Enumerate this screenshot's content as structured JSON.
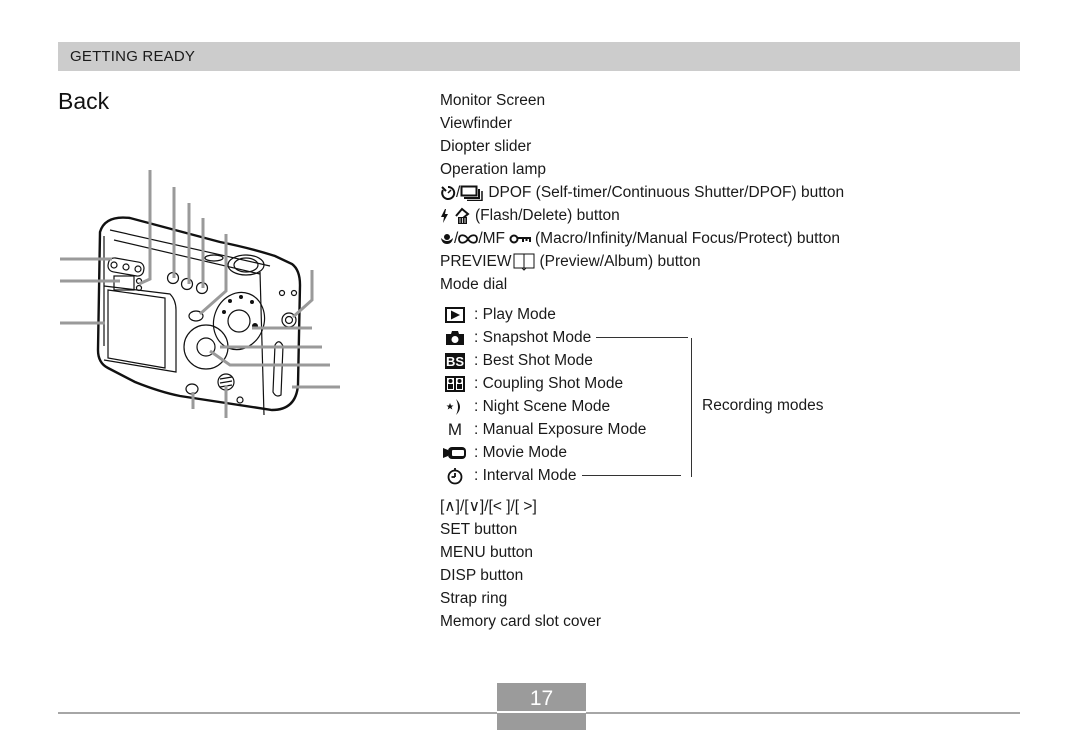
{
  "header": {
    "section": "GETTING READY"
  },
  "title": "Back",
  "parts": [
    {
      "label": "Monitor Screen"
    },
    {
      "label": "Viewfinder"
    },
    {
      "label": "Diopter slider"
    },
    {
      "label": "Operation lamp"
    },
    {
      "icons": [
        "self-timer-icon",
        "continuous-shutter-icon"
      ],
      "prefix": "/",
      "label": "DPOF (Self-timer/Continuous Shutter/DPOF) button"
    },
    {
      "icons": [
        "flash-icon",
        "delete-icon"
      ],
      "label": "(Flash/Delete) button"
    },
    {
      "icons": [
        "macro-icon",
        "infinity-icon",
        "protect-key-icon"
      ],
      "mid": "/MF",
      "label": "(Macro/Infinity/Manual Focus/Protect) button"
    },
    {
      "prefix": "PREVIEW",
      "icons": [
        "album-icon"
      ],
      "label": "(Preview/Album) button"
    },
    {
      "label": "Mode dial"
    }
  ],
  "modes": [
    {
      "icon": "play-mode-icon",
      "label": ": Play Mode"
    },
    {
      "icon": "snapshot-camera-icon",
      "label": ": Snapshot Mode"
    },
    {
      "icon": "best-shot-icon",
      "icon_text": "BS",
      "label": ": Best Shot Mode"
    },
    {
      "icon": "coupling-shot-icon",
      "label": ": Coupling Shot Mode"
    },
    {
      "icon": "night-scene-icon",
      "label": ": Night Scene Mode"
    },
    {
      "icon": "manual-exposure-icon",
      "icon_text": "M",
      "label": ": Manual Exposure Mode"
    },
    {
      "icon": "movie-camera-icon",
      "label": ": Movie Mode"
    },
    {
      "icon": "interval-clock-icon",
      "label": ": Interval Mode"
    }
  ],
  "bracket_label": "Recording modes",
  "parts2": [
    {
      "label": "[∧]/[∨]/[< ]/[ >]"
    },
    {
      "label": "SET button"
    },
    {
      "label": "MENU button"
    },
    {
      "label": "DISP button"
    },
    {
      "label": "Strap ring"
    },
    {
      "label": "Memory card slot cover"
    }
  ],
  "page_number": "17"
}
